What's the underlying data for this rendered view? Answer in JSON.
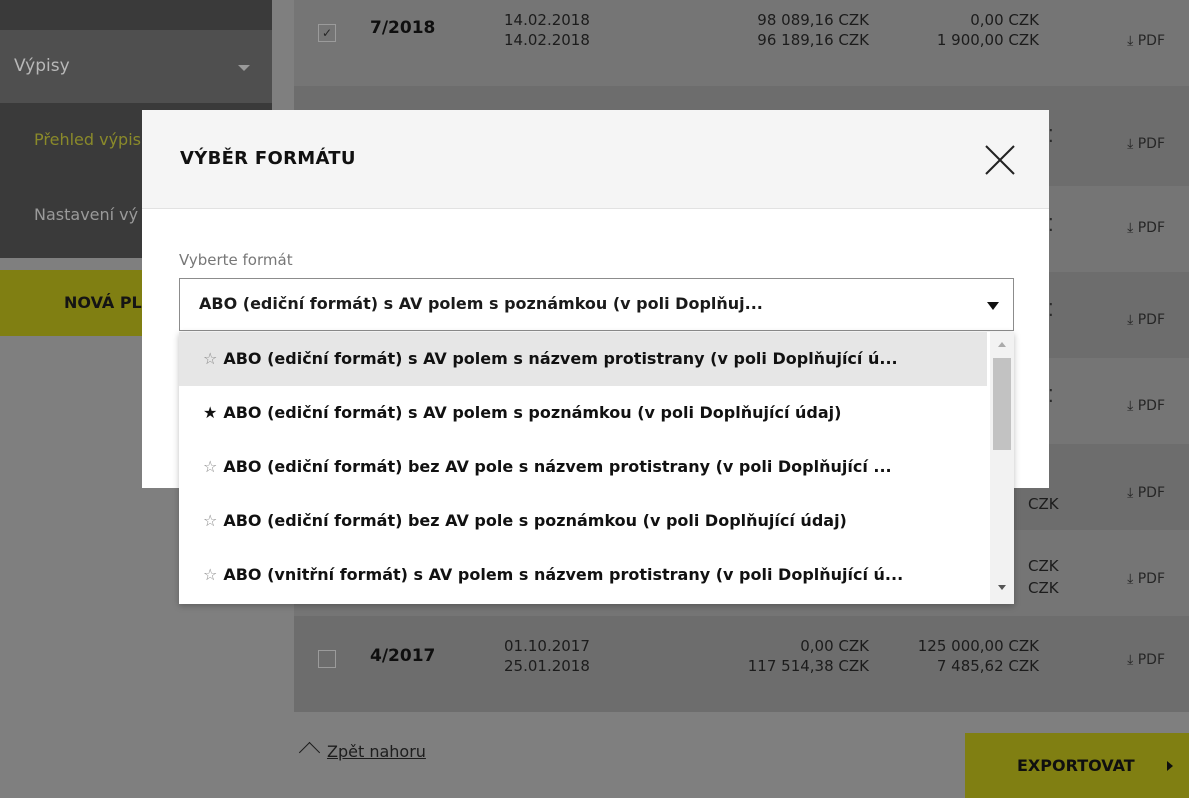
{
  "sidebar": {
    "select_label": "Výpisy",
    "items": [
      {
        "label": "Přehled výpis"
      },
      {
        "label": "Nastavení vý"
      }
    ],
    "new_button_label": "NOVÁ PL"
  },
  "rows": [
    {
      "number": "7/2018",
      "dates": [
        "14.02.2018",
        "14.02.2018"
      ],
      "amounts": [
        "98 089,16 CZK",
        "96 189,16 CZK"
      ],
      "amounts2": [
        "0,00 CZK",
        "1 900,00 CZK"
      ],
      "pdf": "⤓ PDF",
      "checked": true
    },
    {
      "number": "4/2017",
      "dates": [
        "01.10.2017",
        "25.01.2018"
      ],
      "amounts": [
        "0,00 CZK",
        "117 514,38 CZK"
      ],
      "amounts2": [
        "125 000,00 CZK",
        "7 485,62 CZK"
      ],
      "pdf": "⤓ PDF",
      "checked": false
    }
  ],
  "hidden_rows": {
    "pdf": "⤓ PDF",
    "partial_czk_6": "CZK",
    "partial_czk_7a": "CZK",
    "partial_czk_7b": "CZK"
  },
  "footer": {
    "back_to_top": "Zpět nahoru",
    "export_label": "EXPORTOVAT"
  },
  "modal": {
    "title": "VÝBĚR FORMÁTU",
    "field_label": "Vyberte formát",
    "selected_value": "ABO (ediční formát) s AV polem s poznámkou (v poli Doplňuj...",
    "options": [
      {
        "star": "☆",
        "label": "ABO (ediční formát) s AV polem s názvem protistrany (v poli Doplňující ú..."
      },
      {
        "star": "★",
        "label": "ABO (ediční formát) s AV polem s poznámkou (v poli Doplňující údaj)"
      },
      {
        "star": "☆",
        "label": "ABO (ediční formát) bez AV pole s názvem protistrany (v poli Doplňující ..."
      },
      {
        "star": "☆",
        "label": "ABO (ediční formát) bez AV pole s poznámkou (v poli Doplňující údaj)"
      },
      {
        "star": "☆",
        "label": "ABO (vnitřní formát) s AV polem s názvem protistrany (v poli Doplňující ú..."
      }
    ]
  },
  "colors": {
    "accent_olive": "#807f12",
    "overlay_grey": "#7f7f7f",
    "modal_bg": "#ffffff",
    "hover_row": "#e6e6e6"
  }
}
